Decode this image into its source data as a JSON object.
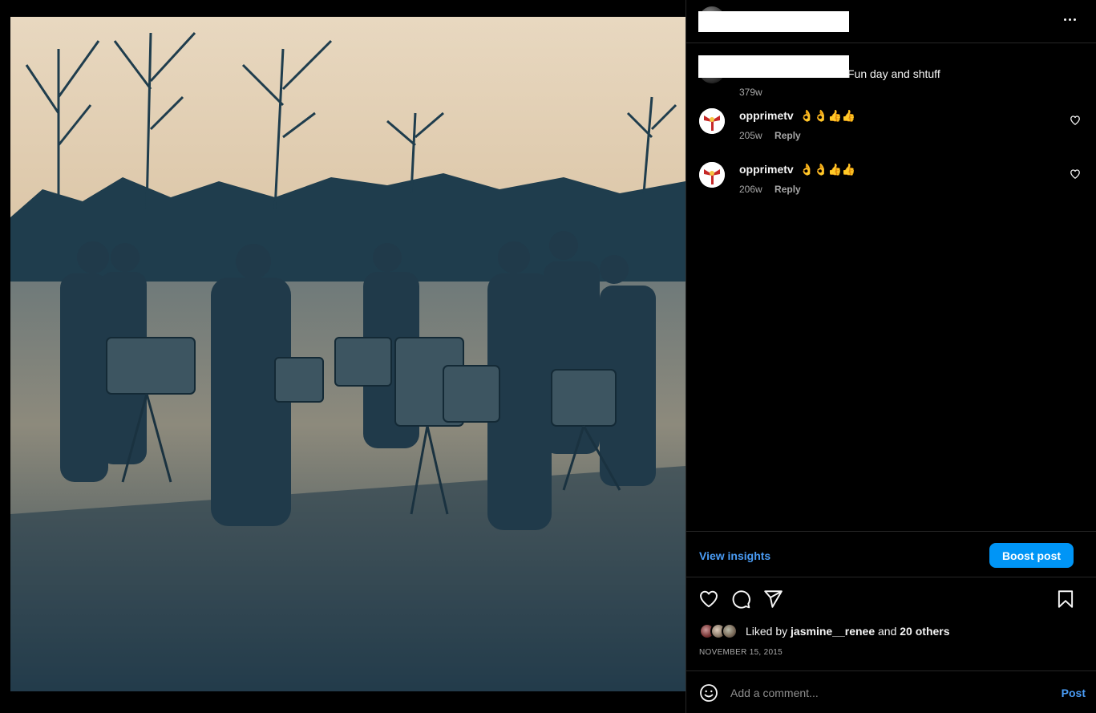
{
  "post": {
    "username_redacted": "",
    "caption": "Fun day and shtuff",
    "caption_time": "379w",
    "date": "NOVEMBER 15, 2015"
  },
  "comments": [
    {
      "username": "opprimetv",
      "text": "👌👌👍👍",
      "time": "205w",
      "reply_label": "Reply"
    },
    {
      "username": "opprimetv",
      "text": "👌👌👍👍",
      "time": "206w",
      "reply_label": "Reply"
    }
  ],
  "insights": {
    "view_label": "View insights",
    "boost_label": "Boost post"
  },
  "likes": {
    "prefix": "Liked by",
    "first_liker": "jasmine__renee",
    "joiner": "and",
    "others": "20 others"
  },
  "comment_input": {
    "placeholder": "Add a comment...",
    "post_label": "Post"
  },
  "icons": {
    "more": "more-options-icon",
    "like": "heart-icon",
    "comment": "comment-bubble-icon",
    "share": "paper-plane-icon",
    "save": "bookmark-icon",
    "emoji": "smiley-icon"
  },
  "colors": {
    "background": "#000000",
    "accent": "#0095f6",
    "link": "#4a9cf5",
    "muted": "#a8a8a8",
    "divider": "#262626"
  }
}
